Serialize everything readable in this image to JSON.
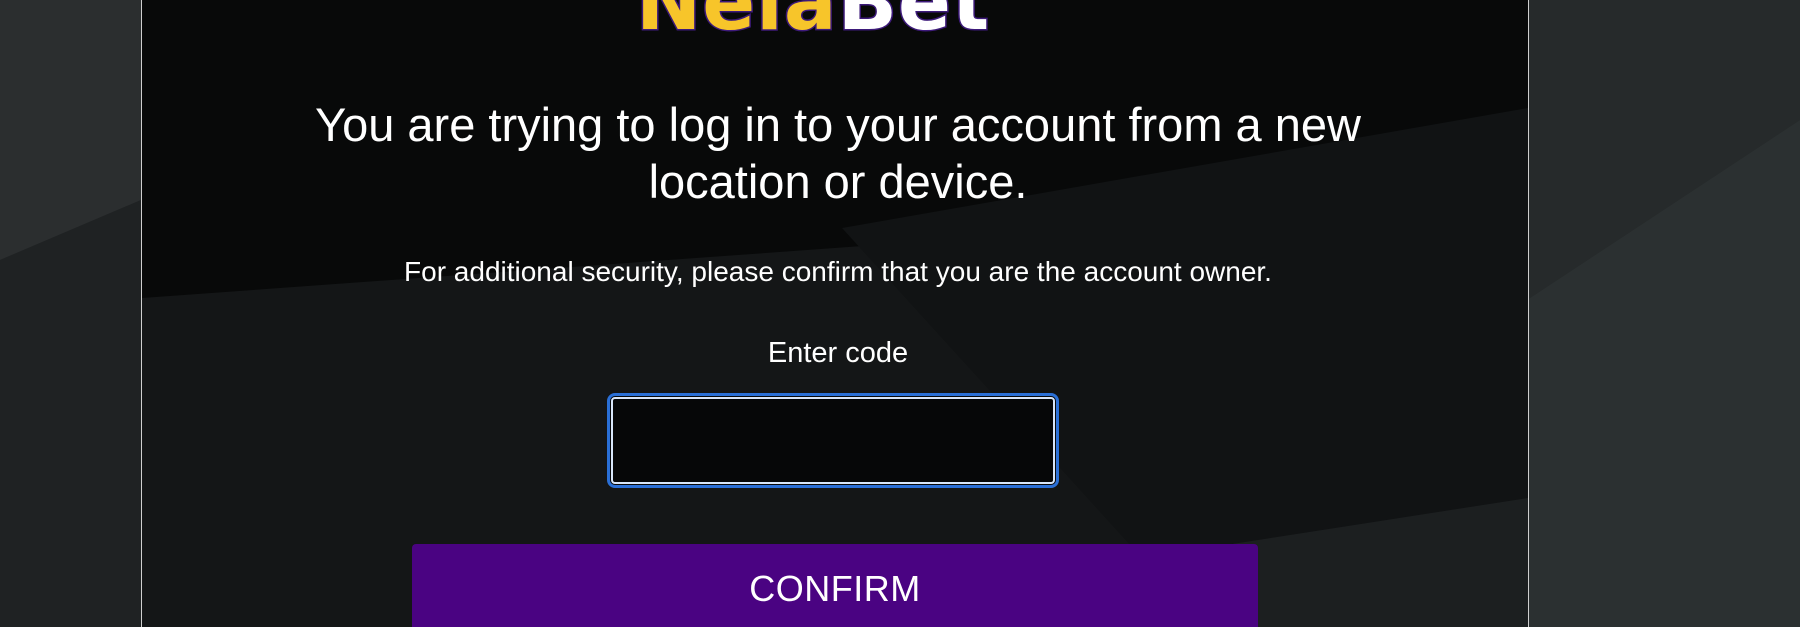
{
  "logo": {
    "part1": "Nela",
    "part2": "Bet"
  },
  "headline": "You are trying to log in to your account from a new location or device.",
  "subtext": "For additional security, please confirm that you are the account owner.",
  "code_label": "Enter code",
  "code_input": {
    "value": "",
    "placeholder": ""
  },
  "confirm_label": "CONFIRM",
  "colors": {
    "background": "#202324",
    "panel": "#0a0b0b",
    "logo_yellow": "#f7c52a",
    "logo_outline": "#3d1a7a",
    "input_focus": "#2a6fd6",
    "button": "#4a0382",
    "text": "#ffffff"
  }
}
